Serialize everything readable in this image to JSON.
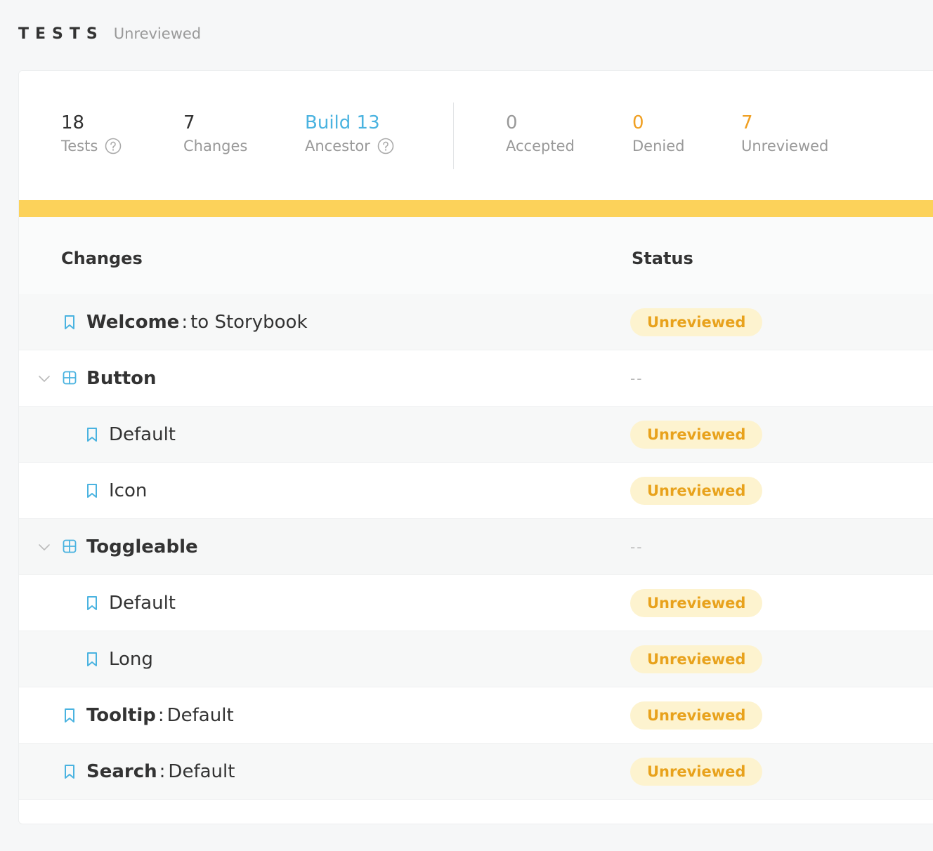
{
  "header": {
    "title": "TESTS",
    "subtitle": "Unreviewed"
  },
  "summary": {
    "tests": {
      "value": "18",
      "label": "Tests"
    },
    "changes": {
      "value": "7",
      "label": "Changes"
    },
    "ancestor": {
      "value": "Build 13",
      "label": "Ancestor"
    },
    "accepted": {
      "value": "0",
      "label": "Accepted"
    },
    "denied": {
      "value": "0",
      "label": "Denied"
    },
    "unreviewed": {
      "value": "7",
      "label": "Unreviewed"
    }
  },
  "colors": {
    "accent_blue": "#4ab3e0",
    "progress_yellow": "#fcd25a",
    "denied_orange": "#f0a023",
    "badge_bg": "#fdf3cf",
    "badge_text": "#e8a21c"
  },
  "progress_unreviewed_fraction": 1.0,
  "table": {
    "headers": {
      "changes": "Changes",
      "status": "Status"
    },
    "rows": [
      {
        "type": "story",
        "level": 0,
        "name": "Welcome",
        "sep": ":",
        "detail": "to Storybook",
        "status": "Unreviewed",
        "icon": "bookmark-icon"
      },
      {
        "type": "group",
        "level": 0,
        "name": "Button",
        "status": "--",
        "icon": "component-grid-icon"
      },
      {
        "type": "story",
        "level": 1,
        "name": "Default",
        "status": "Unreviewed",
        "icon": "bookmark-icon"
      },
      {
        "type": "story",
        "level": 1,
        "name": "Icon",
        "status": "Unreviewed",
        "icon": "bookmark-icon"
      },
      {
        "type": "group",
        "level": 0,
        "name": "Toggleable",
        "status": "--",
        "icon": "component-grid-icon"
      },
      {
        "type": "story",
        "level": 1,
        "name": "Default",
        "status": "Unreviewed",
        "icon": "bookmark-icon"
      },
      {
        "type": "story",
        "level": 1,
        "name": "Long",
        "status": "Unreviewed",
        "icon": "bookmark-icon"
      },
      {
        "type": "story",
        "level": 0,
        "name": "Tooltip",
        "sep": ":",
        "detail": "Default",
        "status": "Unreviewed",
        "icon": "bookmark-icon"
      },
      {
        "type": "story",
        "level": 0,
        "name": "Search",
        "sep": ":",
        "detail": "Default",
        "status": "Unreviewed",
        "icon": "bookmark-icon"
      }
    ]
  }
}
